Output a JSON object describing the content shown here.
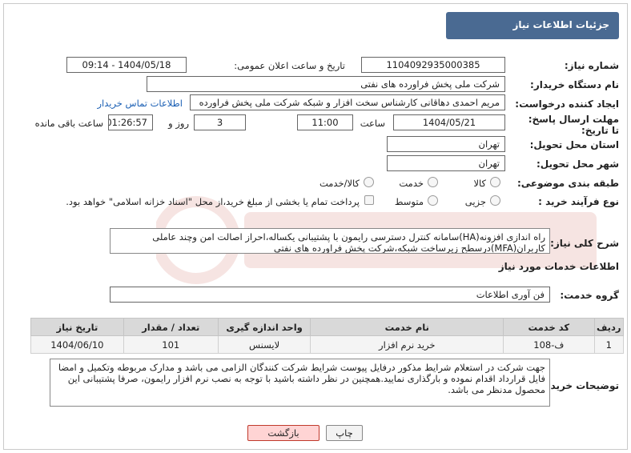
{
  "title": "جزئیات اطلاعات نیاز",
  "fields": {
    "need_number_label": "شماره نیاز:",
    "need_number": "1104092935000385",
    "announce_label": "تاریخ و ساعت اعلان عمومی:",
    "announce_value": "1404/05/18 - 09:14",
    "buyer_org_label": "نام دستگاه خریدار:",
    "buyer_org": "شرکت ملی پخش فراورده های نفتی",
    "creator_label": "ایجاد کننده درخواست:",
    "creator": "مریم احمدی دهاقانی کارشناس سخت افزار و شبکه شرکت ملی پخش فراورده",
    "contact_link": "اطلاعات تماس خریدار",
    "deadline_label": "مهلت ارسال پاسخ: تا تاریخ:",
    "deadline_date": "1404/05/21",
    "time_label": "ساعت",
    "deadline_time": "11:00",
    "days_value": "3",
    "days_label": "روز و",
    "remaining_time": "01:26:57",
    "remaining_label": "ساعت باقی مانده",
    "province_label": "استان محل تحویل:",
    "province": "تهران",
    "city_label": "شهر محل تحویل:",
    "city": "تهران",
    "category_label": "طبقه بندی موضوعی:",
    "category_options": [
      "کالا",
      "خدمت",
      "کالا/خدمت"
    ],
    "process_label": "نوع فرآیند خرید :",
    "process_options": [
      "جزیی",
      "متوسط"
    ],
    "payment_note": "پرداخت تمام یا بخشی از مبلغ خرید،از محل \"اسناد خزانه اسلامی\" خواهد بود."
  },
  "description": {
    "label": "شرح کلی نیاز:",
    "text": "راه اندازی افزونه(HA)سامانه کنترل دسترسی رایمون با پشتیبانی یکساله،احراز اصالت امن وچند عاملی کاربران(MFA)درسطح زیرساخت شبکه،شرکت پخش فراورده های نفتی"
  },
  "services": {
    "section_title": "اطلاعات خدمات مورد نیاز",
    "group_label": "گروه خدمت:",
    "group_value": "فن آوری اطلاعات",
    "headers": [
      "ردیف",
      "کد خدمت",
      "نام خدمت",
      "واحد اندازه گیری",
      "تعداد / مقدار",
      "تاریخ نیاز"
    ],
    "rows": [
      [
        "1",
        "ف-108",
        "خرید نرم افزار",
        "لایسنس",
        "101",
        "1404/06/10"
      ]
    ]
  },
  "buyer_notes": {
    "label": "توضیحات خریدار:",
    "text": "جهت شرکت در استعلام شرایط مذکور درفایل پیوست شرایط شرکت کنندگان الزامی می باشد و مدارک مربوطه وتکمیل و امضا فایل قرارداد اقدام نموده و بارگذاری نمایید.همچنین در نظر داشته باشید با توجه به نصب نرم افزار رایمون، صرفا پشتیبانی این محصول مدنظر می باشد."
  },
  "buttons": {
    "print": "چاپ",
    "back": "بازگشت"
  },
  "colors": {
    "titlebar": "#4a6a92",
    "link": "#1a5fb4",
    "back_button": "#ffd4d4"
  }
}
